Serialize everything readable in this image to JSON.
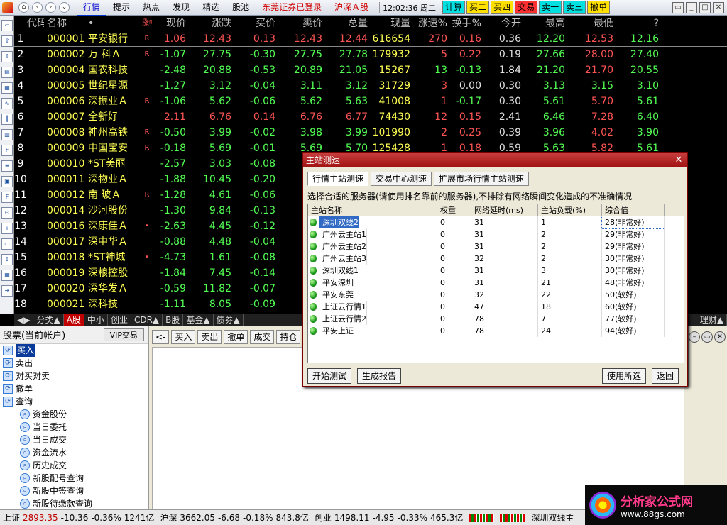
{
  "topbar": {
    "menu": [
      {
        "label": "行情",
        "active": true
      },
      {
        "label": "提示"
      },
      {
        "label": "热点"
      },
      {
        "label": "发现"
      },
      {
        "label": "精选"
      },
      {
        "label": "股池"
      },
      {
        "label": "东莞证券已登录",
        "red": true
      },
      {
        "label": "沪深Ａ股",
        "red": true
      }
    ],
    "clock": "12:02:36 周二",
    "quick": [
      {
        "label": "计算",
        "style": "b"
      },
      {
        "label": "买二",
        "style": "y"
      },
      {
        "label": "买四",
        "style": "y"
      },
      {
        "label": "交易",
        "style": "r"
      },
      {
        "label": "卖一",
        "style": "b"
      },
      {
        "label": "卖三",
        "style": "b"
      },
      {
        "label": "撤单",
        "style": "y"
      }
    ]
  },
  "columns": [
    "",
    "代码",
    "名称",
    "•",
    "涨幅%",
    "现价",
    "涨跌",
    "买价",
    "卖价",
    "总量",
    "现量",
    "涨速%",
    "换手%",
    "今开",
    "最高",
    "最低",
    "?"
  ],
  "rows": [
    {
      "n": "1",
      "code": "000001",
      "name": "平安银行",
      "r": "R",
      "pct": "1.06",
      "price": "12.43",
      "chg": "0.13",
      "bid": "12.43",
      "ask": "12.44",
      "vol": "616654",
      "cur": "270",
      "spd": "0.16",
      "turn": "0.36",
      "open": "12.20",
      "high": "12.53",
      "low": "12.16",
      "t": "up",
      "oT": "dn",
      "hT": "up",
      "lT": "dn",
      "cT": "up",
      "sT": "up"
    },
    {
      "n": "2",
      "code": "000002",
      "name": "万 科Ａ",
      "r": "R",
      "pct": "-1.07",
      "price": "27.75",
      "chg": "-0.30",
      "bid": "27.75",
      "ask": "27.78",
      "vol": "179932",
      "cur": "5",
      "spd": "0.22",
      "turn": "0.19",
      "open": "27.66",
      "high": "28.00",
      "low": "27.40",
      "t": "dn",
      "oT": "dn",
      "hT": "up",
      "lT": "dn",
      "cT": "up",
      "sT": "up"
    },
    {
      "n": "3",
      "code": "000004",
      "name": "国农科技",
      "r": "",
      "pct": "-2.48",
      "price": "20.88",
      "chg": "-0.53",
      "bid": "20.89",
      "ask": "21.05",
      "vol": "15267",
      "cur": "13",
      "spd": "-0.13",
      "turn": "1.84",
      "open": "21.20",
      "high": "21.70",
      "low": "20.55",
      "t": "dn",
      "oT": "dn",
      "hT": "up",
      "lT": "dn",
      "cT": "dn",
      "sT": "dn"
    },
    {
      "n": "4",
      "code": "000005",
      "name": "世纪星源",
      "r": "",
      "pct": "-1.27",
      "price": "3.12",
      "chg": "-0.04",
      "bid": "3.11",
      "ask": "3.12",
      "vol": "31729",
      "cur": "3",
      "spd": "0.00",
      "turn": "0.30",
      "open": "3.13",
      "high": "3.15",
      "low": "3.10",
      "t": "dn",
      "oT": "dn",
      "hT": "dn",
      "lT": "dn",
      "cT": "up",
      "sT": "fl"
    },
    {
      "n": "5",
      "code": "000006",
      "name": "深振业Ａ",
      "r": "R",
      "pct": "-1.06",
      "price": "5.62",
      "chg": "-0.06",
      "bid": "5.62",
      "ask": "5.63",
      "vol": "41008",
      "cur": "1",
      "spd": "-0.17",
      "turn": "0.30",
      "open": "5.61",
      "high": "5.70",
      "low": "5.61",
      "t": "dn",
      "oT": "dn",
      "hT": "up",
      "lT": "dn",
      "cT": "up",
      "sT": "dn"
    },
    {
      "n": "6",
      "code": "000007",
      "name": "全新好",
      "r": "",
      "pct": "2.11",
      "price": "6.76",
      "chg": "0.14",
      "bid": "6.76",
      "ask": "6.77",
      "vol": "74430",
      "cur": "12",
      "spd": "0.15",
      "turn": "2.41",
      "open": "6.46",
      "high": "7.28",
      "low": "6.40",
      "t": "up",
      "oT": "dn",
      "hT": "up",
      "lT": "dn",
      "cT": "up",
      "sT": "up"
    },
    {
      "n": "7",
      "code": "000008",
      "name": "神州高铁",
      "r": "R",
      "pct": "-0.50",
      "price": "3.99",
      "chg": "-0.02",
      "bid": "3.98",
      "ask": "3.99",
      "vol": "101990",
      "cur": "2",
      "spd": "0.25",
      "turn": "0.39",
      "open": "3.96",
      "high": "4.02",
      "low": "3.90",
      "t": "dn",
      "oT": "dn",
      "hT": "up",
      "lT": "dn",
      "cT": "up",
      "sT": "up"
    },
    {
      "n": "8",
      "code": "000009",
      "name": "中国宝安",
      "r": "R",
      "pct": "-0.18",
      "price": "5.69",
      "chg": "-0.01",
      "bid": "5.69",
      "ask": "5.70",
      "vol": "125428",
      "cur": "1",
      "spd": "0.18",
      "turn": "0.59",
      "open": "5.63",
      "high": "5.82",
      "low": "5.61",
      "t": "dn",
      "oT": "dn",
      "hT": "up",
      "lT": "dn",
      "cT": "up",
      "sT": "up"
    },
    {
      "n": "9",
      "code": "000010",
      "name": "*ST美丽",
      "r": "",
      "pct": "-2.57",
      "price": "3.03",
      "chg": "-0.08",
      "bid": "",
      "ask": "",
      "vol": "",
      "cur": "",
      "spd": "",
      "turn": "",
      "open": "",
      "high": "",
      "low": "",
      "t": "dn"
    },
    {
      "n": "10",
      "code": "000011",
      "name": "深物业Ａ",
      "r": "",
      "pct": "-1.88",
      "price": "10.45",
      "chg": "-0.20",
      "bid": "",
      "ask": "",
      "vol": "",
      "cur": "",
      "spd": "",
      "turn": "",
      "open": "",
      "high": "",
      "low": "",
      "t": "dn"
    },
    {
      "n": "11",
      "code": "000012",
      "name": "南 玻Ａ",
      "r": "R",
      "pct": "-1.28",
      "price": "4.61",
      "chg": "-0.06",
      "bid": "",
      "ask": "",
      "vol": "",
      "cur": "",
      "spd": "",
      "turn": "",
      "open": "",
      "high": "",
      "low": "",
      "t": "dn"
    },
    {
      "n": "12",
      "code": "000014",
      "name": "沙河股份",
      "r": "",
      "pct": "-1.30",
      "price": "9.84",
      "chg": "-0.13",
      "bid": "",
      "ask": "",
      "vol": "",
      "cur": "",
      "spd": "",
      "turn": "",
      "open": "",
      "high": "",
      "low": "",
      "t": "dn"
    },
    {
      "n": "13",
      "code": "000016",
      "name": "深康佳Ａ",
      "r": "•",
      "pct": "-2.63",
      "price": "4.45",
      "chg": "-0.12",
      "bid": "",
      "ask": "",
      "vol": "",
      "cur": "",
      "spd": "",
      "turn": "",
      "open": "",
      "high": "",
      "low": "",
      "t": "dn"
    },
    {
      "n": "14",
      "code": "000017",
      "name": "深中华Ａ",
      "r": "",
      "pct": "-0.88",
      "price": "4.48",
      "chg": "-0.04",
      "bid": "",
      "ask": "",
      "vol": "",
      "cur": "",
      "spd": "",
      "turn": "",
      "open": "",
      "high": "",
      "low": "",
      "t": "dn"
    },
    {
      "n": "15",
      "code": "000018",
      "name": "*ST神城",
      "r": "•",
      "pct": "-4.73",
      "price": "1.61",
      "chg": "-0.08",
      "bid": "",
      "ask": "",
      "vol": "",
      "cur": "",
      "spd": "",
      "turn": "",
      "open": "",
      "high": "",
      "low": "",
      "t": "dn"
    },
    {
      "n": "16",
      "code": "000019",
      "name": "深粮控股",
      "r": "",
      "pct": "-1.84",
      "price": "7.45",
      "chg": "-0.14",
      "bid": "",
      "ask": "",
      "vol": "",
      "cur": "",
      "spd": "",
      "turn": "",
      "open": "",
      "high": "",
      "low": "",
      "t": "dn"
    },
    {
      "n": "17",
      "code": "000020",
      "name": "深华发Ａ",
      "r": "",
      "pct": "-0.59",
      "price": "11.82",
      "chg": "-0.07",
      "bid": "",
      "ask": "",
      "vol": "",
      "cur": "",
      "spd": "",
      "turn": "",
      "open": "",
      "high": "",
      "low": "",
      "t": "dn"
    },
    {
      "n": "18",
      "code": "000021",
      "name": "深科技",
      "r": "",
      "pct": "-1.11",
      "price": "8.05",
      "chg": "-0.09",
      "bid": "",
      "ask": "",
      "vol": "",
      "cur": "",
      "spd": "",
      "turn": "",
      "open": "",
      "high": "",
      "low": "",
      "t": "dn"
    }
  ],
  "tabs": [
    "◀▶",
    "分类▲",
    "A股",
    "中小",
    "创业",
    "CDR▲",
    "B股",
    "基金▲",
    "债券▲"
  ],
  "tabs_right": "理财▲",
  "tree": {
    "title": "股票(当前帐户)",
    "vip": "VIP交易",
    "items": [
      {
        "label": "买入",
        "on": true
      },
      {
        "label": "卖出"
      },
      {
        "label": "对买对卖"
      },
      {
        "label": "撤单"
      },
      {
        "label": "查询"
      }
    ],
    "sub": [
      "资金股份",
      "当日委托",
      "当日成交",
      "资金流水",
      "历史成交",
      "新股配号查询",
      "新股中签查询",
      "新股待缴款查询"
    ]
  },
  "trade_toolbar": [
    "<-",
    "买入",
    "卖出",
    "撤单",
    "成交",
    "持仓"
  ],
  "status": {
    "sh_label": "上证",
    "sh_val": "2893.35",
    "sh_chg": "-10.36",
    "sh_pct": "-0.36%",
    "sh_amt": "1241亿",
    "hs_label": "沪深",
    "hs_val": "3662.05",
    "hs_chg": "-6.68",
    "hs_pct": "-0.18%",
    "hs_amt": "843.8亿",
    "cy_label": "创业",
    "cy_val": "1498.11",
    "cy_chg": "-4.95",
    "cy_pct": "-0.33%",
    "cy_amt": "465.3亿",
    "server": "深圳双线主"
  },
  "brand": {
    "title": "分析家公式网",
    "url": "www.88gs.com"
  },
  "dialog": {
    "title": "主站测速",
    "close": "✕",
    "tabs": [
      "行情主站测速",
      "交易中心测速",
      "扩展市场行情主站测速"
    ],
    "hint": "选择合适的服务器(请使用排名靠前的服务器),不排除有网络瞬间变化造成的不准确情况",
    "headers": [
      "主站名称",
      "权重",
      "网络延时(ms)",
      "主站负载(%)",
      "综合值"
    ],
    "rows": [
      {
        "name": "深圳双线2",
        "w": "0",
        "lat": "31",
        "load": "1",
        "score": "28(非常好)",
        "sel": true
      },
      {
        "name": "广州云主站1",
        "w": "0",
        "lat": "31",
        "load": "2",
        "score": "29(非常好)"
      },
      {
        "name": "广州云主站2",
        "w": "0",
        "lat": "31",
        "load": "2",
        "score": "29(非常好)"
      },
      {
        "name": "广州云主站3",
        "w": "0",
        "lat": "32",
        "load": "2",
        "score": "30(非常好)"
      },
      {
        "name": "深圳双线1",
        "w": "0",
        "lat": "31",
        "load": "3",
        "score": "30(非常好)"
      },
      {
        "name": "平安深圳",
        "w": "0",
        "lat": "31",
        "load": "21",
        "score": "48(非常好)"
      },
      {
        "name": "平安东莞",
        "w": "0",
        "lat": "32",
        "load": "22",
        "score": "50(较好)"
      },
      {
        "name": "上证云行情1",
        "w": "0",
        "lat": "47",
        "load": "18",
        "score": "60(较好)"
      },
      {
        "name": "上证云行情2",
        "w": "0",
        "lat": "78",
        "load": "7",
        "score": "77(较好)"
      },
      {
        "name": "平安上证",
        "w": "0",
        "lat": "78",
        "load": "24",
        "score": "94(较好)"
      }
    ],
    "buttons": {
      "start": "开始测试",
      "report": "生成报告",
      "use": "使用所选",
      "back": "返回"
    }
  }
}
